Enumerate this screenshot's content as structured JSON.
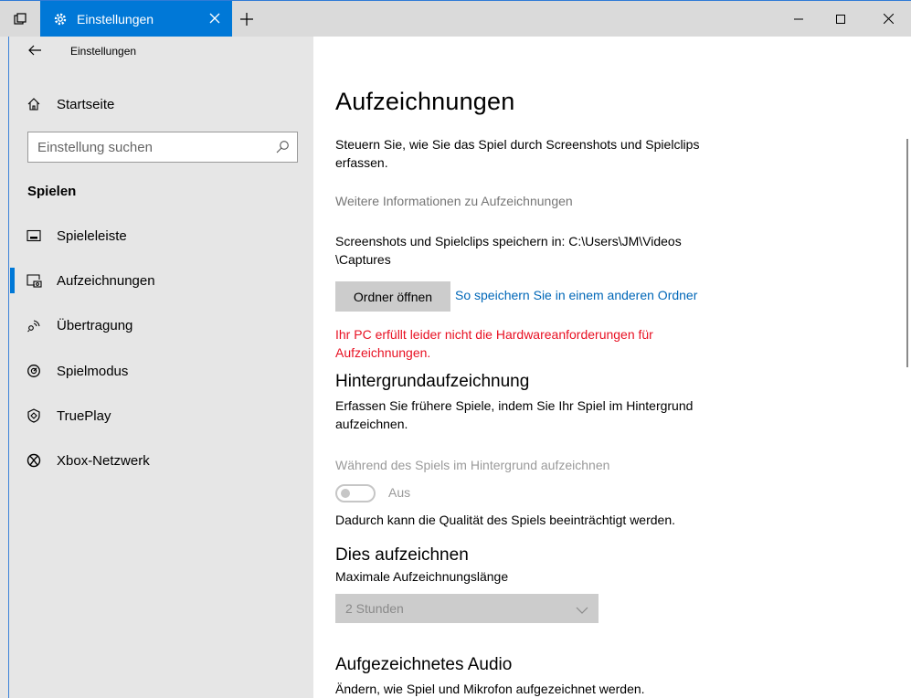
{
  "window": {
    "tab_title": "Einstellungen"
  },
  "nav": {
    "back_title": "Einstellungen",
    "home_label": "Startseite",
    "search_placeholder": "Einstellung suchen",
    "section_title": "Spielen",
    "items": [
      {
        "label": "Spieleleiste",
        "icon": "game-bar-icon"
      },
      {
        "label": "Aufzeichnungen",
        "icon": "captures-icon",
        "selected": true
      },
      {
        "label": "Übertragung",
        "icon": "broadcasting-icon"
      },
      {
        "label": "Spielmodus",
        "icon": "game-mode-icon"
      },
      {
        "label": "TruePlay",
        "icon": "trueplay-icon"
      },
      {
        "label": "Xbox-Netzwerk",
        "icon": "xbox-icon"
      }
    ]
  },
  "main": {
    "title": "Aufzeichnungen",
    "intro_line1": "Steuern Sie, wie Sie das Spiel durch Screenshots und Spielclips",
    "intro_line2": "erfassen.",
    "more_info": "Weitere Informationen zu Aufzeichnungen",
    "save_path_line1": "Screenshots und Spielclips speichern in: C:\\Users\\JM\\Videos",
    "save_path_line2": "\\Captures",
    "open_folder_button": "Ordner öffnen",
    "other_folder_link": "So speichern Sie in einem anderen Ordner",
    "hw_warning_line1": "Ihr PC erfüllt leider nicht die Hardwareanforderungen für",
    "hw_warning_line2": "Aufzeichnungen.",
    "bg_heading": "Hintergrundaufzeichnung",
    "bg_desc_line1": "Erfassen Sie frühere Spiele, indem Sie Ihr Spiel im Hintergrund",
    "bg_desc_line2": "aufzeichnen.",
    "bg_toggle_label": "Während des Spiels im Hintergrund aufzeichnen",
    "bg_toggle_state": "Aus",
    "bg_quality_note": "Dadurch kann die Qualität des Spiels beeinträchtigt werden.",
    "record_heading": "Dies aufzeichnen",
    "max_length_label": "Maximale Aufzeichnungslänge",
    "max_length_value": "2 Stunden",
    "audio_heading": "Aufgezeichnetes Audio",
    "audio_desc": "Ändern, wie Spiel und Mikrofon aufgezeichnet werden."
  },
  "colors": {
    "accent": "#0078d7",
    "link": "#0067b8",
    "warning": "#e81123",
    "nav_bg": "#e6e6e6"
  }
}
